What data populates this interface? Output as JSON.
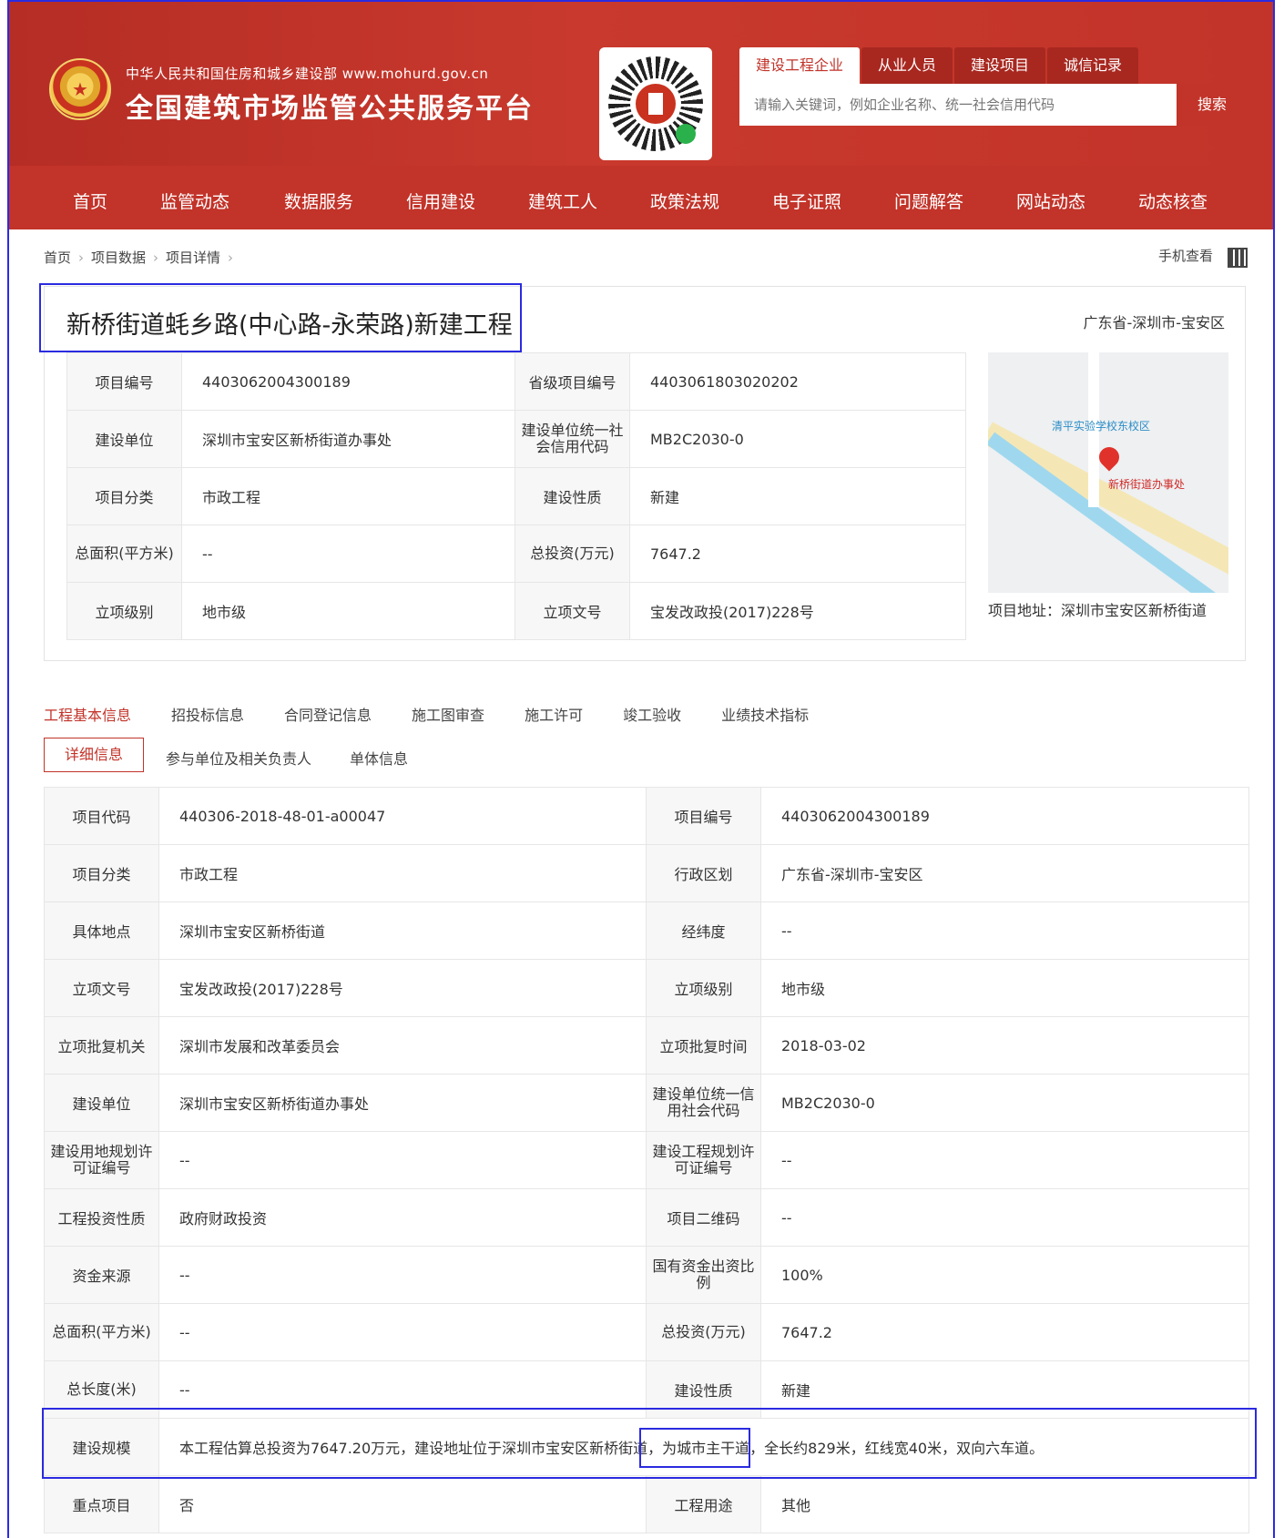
{
  "header": {
    "org_name": "中华人民共和国住房和城乡建设部  www.mohurd.gov.cn",
    "site_title": "全国建筑市场监管公共服务平台",
    "search_tabs": [
      "建设工程企业",
      "从业人员",
      "建设项目",
      "诚信记录"
    ],
    "search_placeholder": "请输入关键词，例如企业名称、统一社会信用代码",
    "search_button": "搜索"
  },
  "nav": [
    "首页",
    "监管动态",
    "数据服务",
    "信用建设",
    "建筑工人",
    "政策法规",
    "电子证照",
    "问题解答",
    "网站动态",
    "动态核查"
  ],
  "breadcrumb": [
    "首页",
    "项目数据",
    "项目详情"
  ],
  "mobile_view": "手机查看",
  "project": {
    "title": "新桥街道蚝乡路(中心路-永荣路)新建工程",
    "region": "广东省-深圳市-宝安区",
    "map_address": "项目地址：深圳市宝安区新桥街道",
    "map_label_school": "清平实验学校东校区",
    "map_label_office": "新桥街道办事处"
  },
  "summary": [
    {
      "k1": "项目编号",
      "v1": "4403062004300189",
      "k2": "省级项目编号",
      "v2": "4403061803020202"
    },
    {
      "k1": "建设单位",
      "v1": "深圳市宝安区新桥街道办事处",
      "k2": "建设单位统一社会信用代码",
      "v2": "MB2C2030-0"
    },
    {
      "k1": "项目分类",
      "v1": "市政工程",
      "k2": "建设性质",
      "v2": "新建"
    },
    {
      "k1": "总面积(平方米)",
      "v1": "--",
      "k2": "总投资(万元)",
      "v2": "7647.2"
    },
    {
      "k1": "立项级别",
      "v1": "地市级",
      "k2": "立项文号",
      "v2": "宝发改政投(2017)228号"
    }
  ],
  "tabs": [
    "工程基本信息",
    "招投标信息",
    "合同登记信息",
    "施工图审查",
    "施工许可",
    "竣工验收",
    "业绩技术指标"
  ],
  "subtabs": [
    "详细信息",
    "参与单位及相关负责人",
    "单体信息"
  ],
  "detail": [
    {
      "k1": "项目代码",
      "v1": "440306-2018-48-01-a00047",
      "k2": "项目编号",
      "v2": "4403062004300189"
    },
    {
      "k1": "项目分类",
      "v1": "市政工程",
      "k2": "行政区划",
      "v2": "广东省-深圳市-宝安区"
    },
    {
      "k1": "具体地点",
      "v1": "深圳市宝安区新桥街道",
      "k2": "经纬度",
      "v2": "--"
    },
    {
      "k1": "立项文号",
      "v1": "宝发改政投(2017)228号",
      "k2": "立项级别",
      "v2": "地市级"
    },
    {
      "k1": "立项批复机关",
      "v1": "深圳市发展和改革委员会",
      "k2": "立项批复时间",
      "v2": "2018-03-02"
    },
    {
      "k1": "建设单位",
      "v1": "深圳市宝安区新桥街道办事处",
      "k2": "建设单位统一信用社会代码",
      "v2": "MB2C2030-0"
    },
    {
      "k1": "建设用地规划许可证编号",
      "v1": "--",
      "k2": "建设工程规划许可证编号",
      "v2": "--"
    },
    {
      "k1": "工程投资性质",
      "v1": "政府财政投资",
      "k2": "项目二维码",
      "v2": "--"
    },
    {
      "k1": "资金来源",
      "v1": "--",
      "k2": "国有资金出资比例",
      "v2": "100%"
    },
    {
      "k1": "总面积(平方米)",
      "v1": "--",
      "k2": "总投资(万元)",
      "v2": "7647.2"
    },
    {
      "k1": "总长度(米)",
      "v1": "--",
      "k2": "建设性质",
      "v2": "新建"
    }
  ],
  "scale": {
    "k": "建设规模",
    "v": "本工程估算总投资为7647.20万元，建设地址位于深圳市宝安区新桥街道，为城市主干道，全长约829米，红线宽40米，双向六车道。"
  },
  "last_row": {
    "k1": "重点项目",
    "v1": "否",
    "k2": "工程用途",
    "v2": "其他"
  }
}
